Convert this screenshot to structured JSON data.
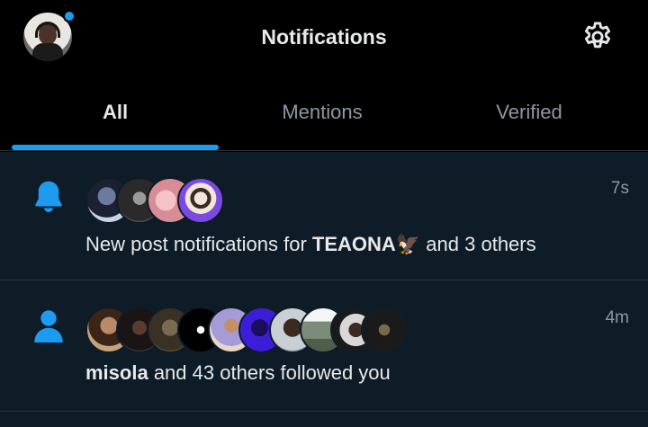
{
  "header": {
    "title": "Notifications",
    "has_unread_dot": true
  },
  "tabs": [
    {
      "label": "All",
      "active": true
    },
    {
      "label": "Mentions",
      "active": false
    },
    {
      "label": "Verified",
      "active": false
    }
  ],
  "notifications": [
    {
      "icon": "bell-icon",
      "time": "7s",
      "text_prefix": "New post notifications for ",
      "name": "TEAONA🦅",
      "text_suffix": " and 3 others",
      "avatar_count": 4
    },
    {
      "icon": "person-icon",
      "time": "4m",
      "name": "misola",
      "text_suffix": " and 43 others followed you",
      "avatar_count": 10
    }
  ],
  "colors": {
    "accent": "#1d9bf0",
    "background": "#000000",
    "list_background": "#0e1c28",
    "muted_text": "#8b98a5"
  }
}
